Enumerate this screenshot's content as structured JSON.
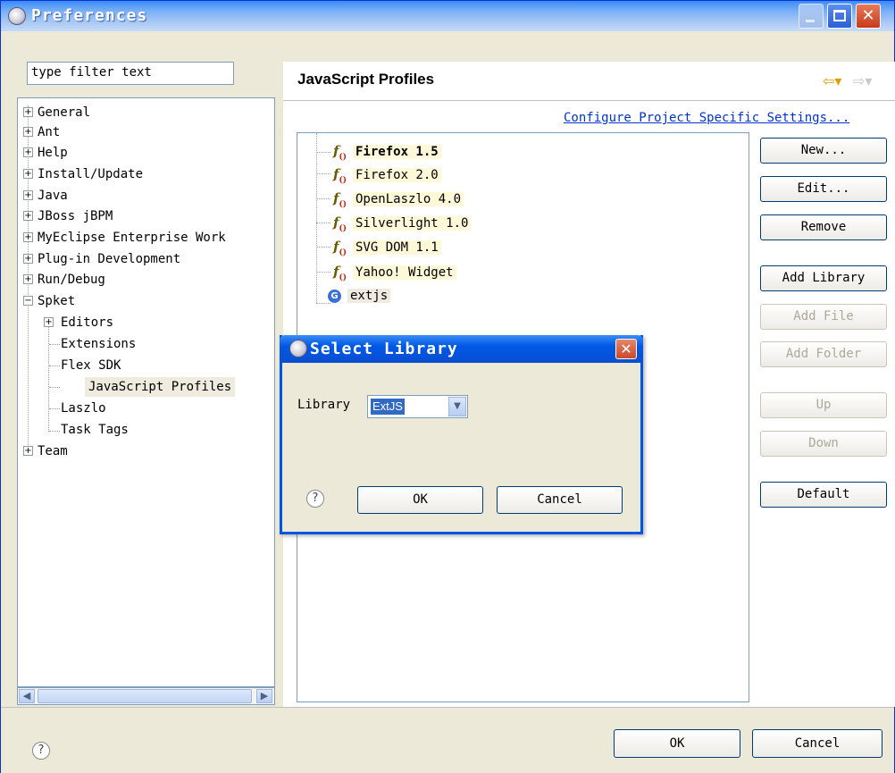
{
  "window": {
    "title": "Preferences"
  },
  "filter": {
    "value": "type filter text"
  },
  "tree": {
    "items": [
      {
        "label": "General",
        "expander": "+"
      },
      {
        "label": "Ant",
        "expander": "+"
      },
      {
        "label": "Help",
        "expander": "+"
      },
      {
        "label": "Install/Update",
        "expander": "+"
      },
      {
        "label": "Java",
        "expander": "+"
      },
      {
        "label": "JBoss jBPM",
        "expander": "+"
      },
      {
        "label": "MyEclipse Enterprise Work",
        "expander": "+"
      },
      {
        "label": "Plug-in Development",
        "expander": "+"
      },
      {
        "label": "Run/Debug",
        "expander": "+"
      },
      {
        "label": "Spket",
        "expander": "−"
      },
      {
        "label": "Editors",
        "expander": "+"
      },
      {
        "label": "Extensions"
      },
      {
        "label": "Flex SDK"
      },
      {
        "label": "JavaScript Profiles",
        "selected": true
      },
      {
        "label": "Laszlo"
      },
      {
        "label": "Task Tags"
      },
      {
        "label": "Team",
        "expander": "+"
      }
    ]
  },
  "page": {
    "title": "JavaScript Profiles",
    "configure_link": "Configure Project Specific Settings...",
    "profiles": [
      {
        "label": "Firefox 1.5",
        "icon": "function-icon",
        "bold": true
      },
      {
        "label": "Firefox 2.0",
        "icon": "function-icon"
      },
      {
        "label": "OpenLaszlo 4.0",
        "icon": "function-icon"
      },
      {
        "label": "Silverlight 1.0",
        "icon": "function-icon"
      },
      {
        "label": "SVG DOM 1.1",
        "icon": "function-icon"
      },
      {
        "label": "Yahoo! Widget",
        "icon": "function-icon"
      },
      {
        "label": "extjs",
        "icon": "library-icon"
      }
    ],
    "buttons": {
      "new": "New...",
      "edit": "Edit...",
      "remove": "Remove",
      "add_library": "Add Library",
      "add_file": "Add File",
      "add_folder": "Add Folder",
      "up": "Up",
      "down": "Down",
      "default": "Default"
    }
  },
  "footer": {
    "ok": "OK",
    "cancel": "Cancel"
  },
  "dialog": {
    "title": "Select Library",
    "library_label": "Library",
    "library_value": "ExtJS",
    "ok": "OK",
    "cancel": "Cancel"
  }
}
